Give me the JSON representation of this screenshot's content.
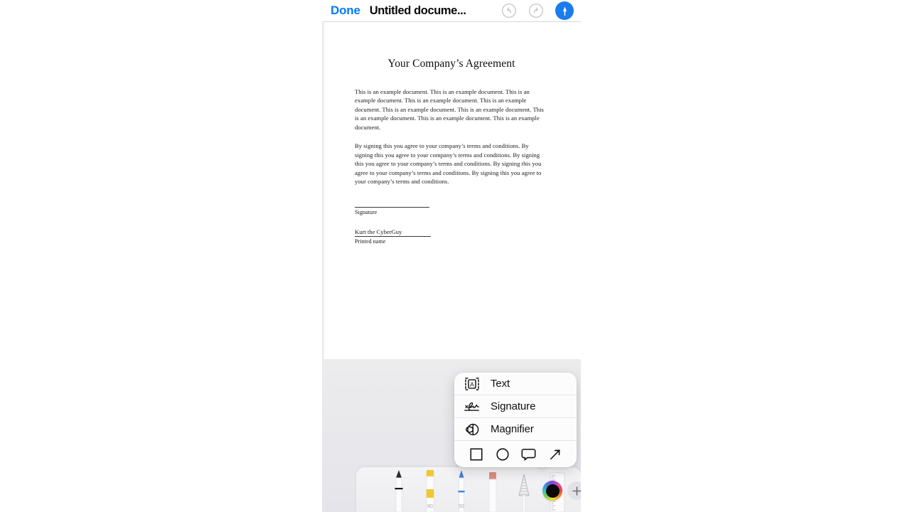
{
  "navbar": {
    "done_label": "Done",
    "title": "Untitled docume...",
    "undo_icon": "undo-arrow-icon",
    "redo_icon": "redo-arrow-icon",
    "markup_icon": "markup-pen-icon",
    "accent_color": "#007AFF",
    "markup_button_color": "#1B7CED"
  },
  "document": {
    "title": "Your Company’s Agreement",
    "paragraph1": "This is an example document. This is an example document. This is an example document. This is an example document. This is an example document. This is an example document. This is an example document. This is an example document. This is an example document. This is an example document.",
    "paragraph2": "By signing this you agree to your company’s terms and conditions. By signing this you agree to your company’s terms and conditions. By signing this you agree to your company’s terms and conditions. By signing this you agree to your company’s terms and conditions. By signing this you agree to your company’s terms and conditions.",
    "signature_label": "Signature",
    "printed_name_value": "Kurt the CyberGuy",
    "printed_name_label": "Printed name"
  },
  "popup": {
    "items": [
      {
        "label": "Text",
        "icon": "text-box-icon"
      },
      {
        "label": "Signature",
        "icon": "signature-icon"
      },
      {
        "label": "Magnifier",
        "icon": "magnifier-icon"
      }
    ],
    "shapes": [
      {
        "name": "square-shape-icon"
      },
      {
        "name": "circle-shape-icon"
      },
      {
        "name": "speech-bubble-shape-icon"
      },
      {
        "name": "arrow-shape-icon"
      }
    ]
  },
  "toolbar": {
    "tools": [
      {
        "name": "pen-tool",
        "color": "#1A1A1A",
        "number": ""
      },
      {
        "name": "highlighter-tool",
        "color": "#F2C832",
        "number": "80"
      },
      {
        "name": "pencil-tool",
        "color": "#3F7FE0",
        "number": "50"
      },
      {
        "name": "eraser-tool",
        "color": "#E08A84",
        "number": ""
      },
      {
        "name": "lasso-tool",
        "color": "#9A9A9F",
        "number": ""
      },
      {
        "name": "ruler-tool",
        "color": "#B0B0B5",
        "number": ""
      }
    ],
    "color_picker": {
      "name": "color-picker",
      "selected_color": "#0A0A0A"
    },
    "add_button": {
      "name": "add-tool-button",
      "label": "+"
    }
  }
}
